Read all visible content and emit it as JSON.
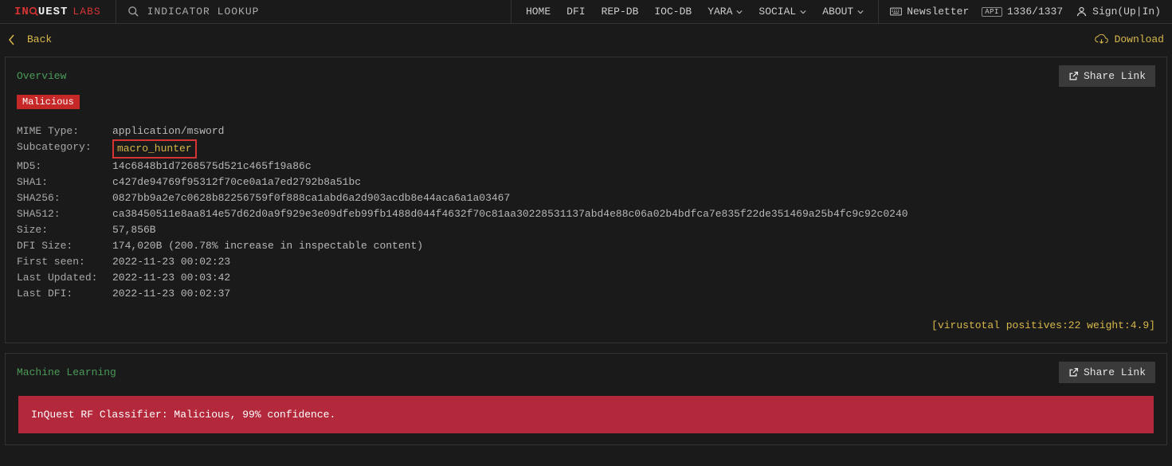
{
  "logo": {
    "in": "IN",
    "uest": "UEST",
    "labs": "LABS"
  },
  "search": {
    "label": "INDICATOR LOOKUP"
  },
  "nav": {
    "home": "HOME",
    "dfi": "DFI",
    "repdb": "REP-DB",
    "iocdb": "IOC-DB",
    "yara": "YARA",
    "social": "SOCIAL",
    "about": "ABOUT"
  },
  "top_right": {
    "newsletter": "Newsletter",
    "api_badge": "API",
    "api_counter": "1336/1337",
    "sign": "Sign(Up|In)"
  },
  "back": {
    "label": "Back",
    "download": "Download"
  },
  "overview": {
    "title": "Overview",
    "share": "Share Link",
    "badge": "Malicious",
    "rows": {
      "mime_key": "MIME Type:",
      "mime_val": "application/msword",
      "subcat_key": "Subcategory:",
      "subcat_val": "macro_hunter",
      "md5_key": "MD5:",
      "md5_val": "14c6848b1d7268575d521c465f19a86c",
      "sha1_key": "SHA1:",
      "sha1_val": "c427de94769f95312f70ce0a1a7ed2792b8a51bc",
      "sha256_key": "SHA256:",
      "sha256_val": "0827bb9a2e7c0628b82256759f0f888ca1abd6a2d903acdb8e44aca6a1a03467",
      "sha512_key": "SHA512:",
      "sha512_val": "ca38450511e8aa814e57d62d0a9f929e3e09dfeb99fb1488d044f4632f70c81aa30228531137abd4e88c06a02b4bdfca7e835f22de351469a25b4fc9c92c0240",
      "size_key": "Size:",
      "size_val": "57,856B",
      "dfisize_key": "DFI Size:",
      "dfisize_val": "174,020B (200.78% increase in inspectable content)",
      "firstseen_key": "First seen:",
      "firstseen_val": "2022-11-23 00:02:23",
      "lastupdated_key": "Last Updated:",
      "lastupdated_val": "2022-11-23 00:03:42",
      "lastdfi_key": "Last DFI:",
      "lastdfi_val": "2022-11-23 00:02:37"
    },
    "vt_footer": "[virustotal positives:22 weight:4.9]"
  },
  "ml": {
    "title": "Machine Learning",
    "share": "Share Link",
    "result": "InQuest RF Classifier:  Malicious, 99% confidence."
  }
}
